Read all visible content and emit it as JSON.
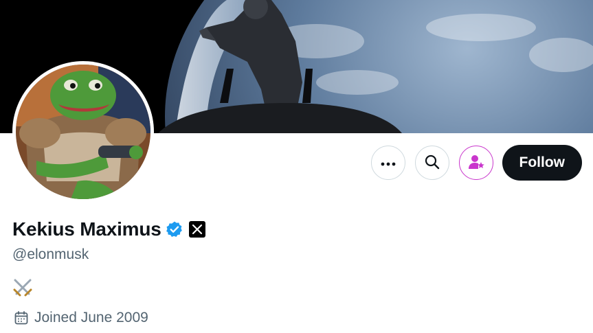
{
  "profile": {
    "display_name": "Kekius Maximus",
    "handle": "@elonmusk",
    "bio_emoji": "⚔️",
    "joined": "Joined June 2009",
    "verified_icon": "verified-badge-icon",
    "affiliate_icon": "x-logo-icon"
  },
  "actions": {
    "more_icon": "more-icon",
    "search_icon": "search-icon",
    "subscribe_icon": "person-star-icon",
    "follow_label": "Follow"
  },
  "colors": {
    "verified": "#1d9bf0",
    "follow_bg": "#0f1419",
    "subscribe_accent": "#c936cc",
    "secondary_text": "#536471"
  }
}
